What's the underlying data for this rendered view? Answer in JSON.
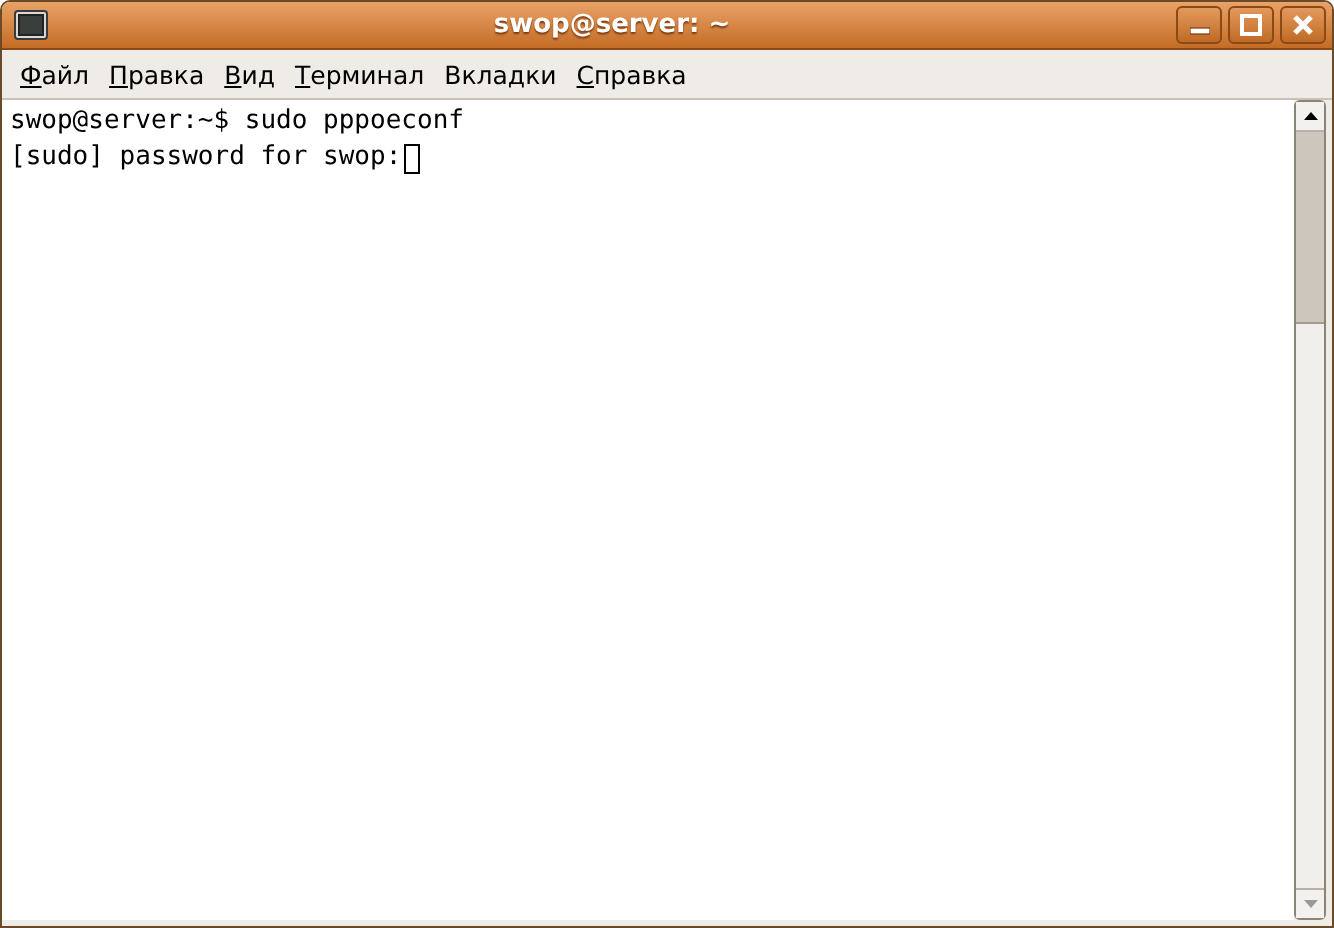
{
  "window": {
    "title": "swop@server: ~"
  },
  "menu": [
    {
      "mnemonic": "Ф",
      "after": "айл"
    },
    {
      "mnemonic": "П",
      "after": "равка"
    },
    {
      "mnemonic": "В",
      "after": "ид"
    },
    {
      "mnemonic": "Т",
      "after": "ерминал"
    },
    {
      "before": "Вкла",
      "mnemonic": "д",
      "after": "ки"
    },
    {
      "mnemonic": "С",
      "after": "правка"
    }
  ],
  "terminal": {
    "lines": [
      "swop@server:~$ sudo pppoeconf",
      "[sudo] password for swop:"
    ],
    "cursor": true
  }
}
